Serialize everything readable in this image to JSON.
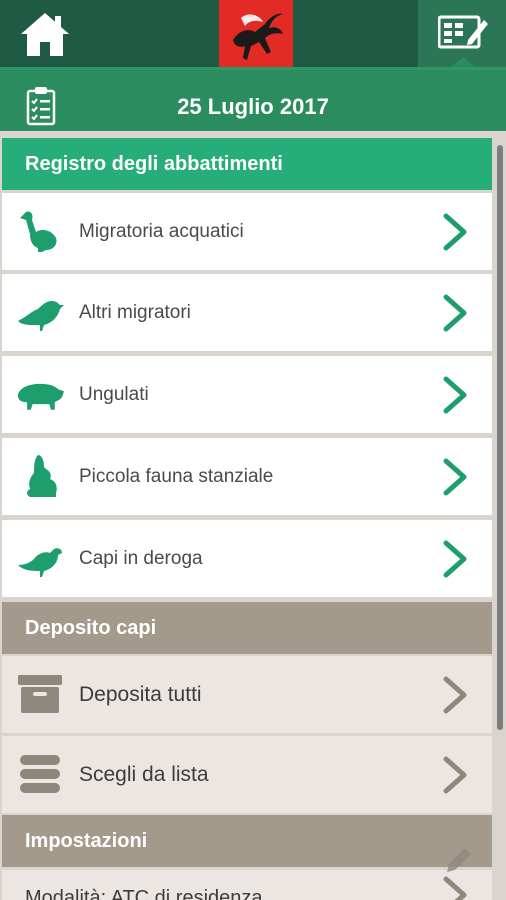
{
  "header": {
    "home_icon": "home-icon",
    "logo": "regione-toscana-pegasus-logo",
    "active_tab_icon": "register-edit-icon"
  },
  "date_bar": {
    "icon": "clipboard-checklist-icon",
    "date": "25 Luglio 2017"
  },
  "sections": {
    "registro": {
      "title": "Registro degli abbattimenti",
      "items": [
        {
          "label": "Migratoria acquatici",
          "icon": "waterbird-icon"
        },
        {
          "label": "Altri migratori",
          "icon": "bird-icon"
        },
        {
          "label": "Ungulati",
          "icon": "boar-icon"
        },
        {
          "label": "Piccola fauna stanziale",
          "icon": "hare-icon"
        },
        {
          "label": "Capi in deroga",
          "icon": "pigeon-icon"
        }
      ]
    },
    "deposito": {
      "title": "Deposito capi",
      "items": [
        {
          "label": "Deposita tutti",
          "icon": "archive-box-icon"
        },
        {
          "label": "Scegli da lista",
          "icon": "list-stack-icon"
        }
      ]
    },
    "impostazioni": {
      "title": "Impostazioni",
      "items": [
        {
          "label": "Modalità: ATC di residenza",
          "icon": "chevron-right-icon"
        }
      ]
    }
  },
  "colors": {
    "header_dark_green": "#1f5b44",
    "bar_green": "#2a8c5f",
    "section_green": "#27ad7a",
    "section_brown": "#a39a8b",
    "icon_green": "#1e9e6c",
    "icon_brown": "#8f877c"
  }
}
